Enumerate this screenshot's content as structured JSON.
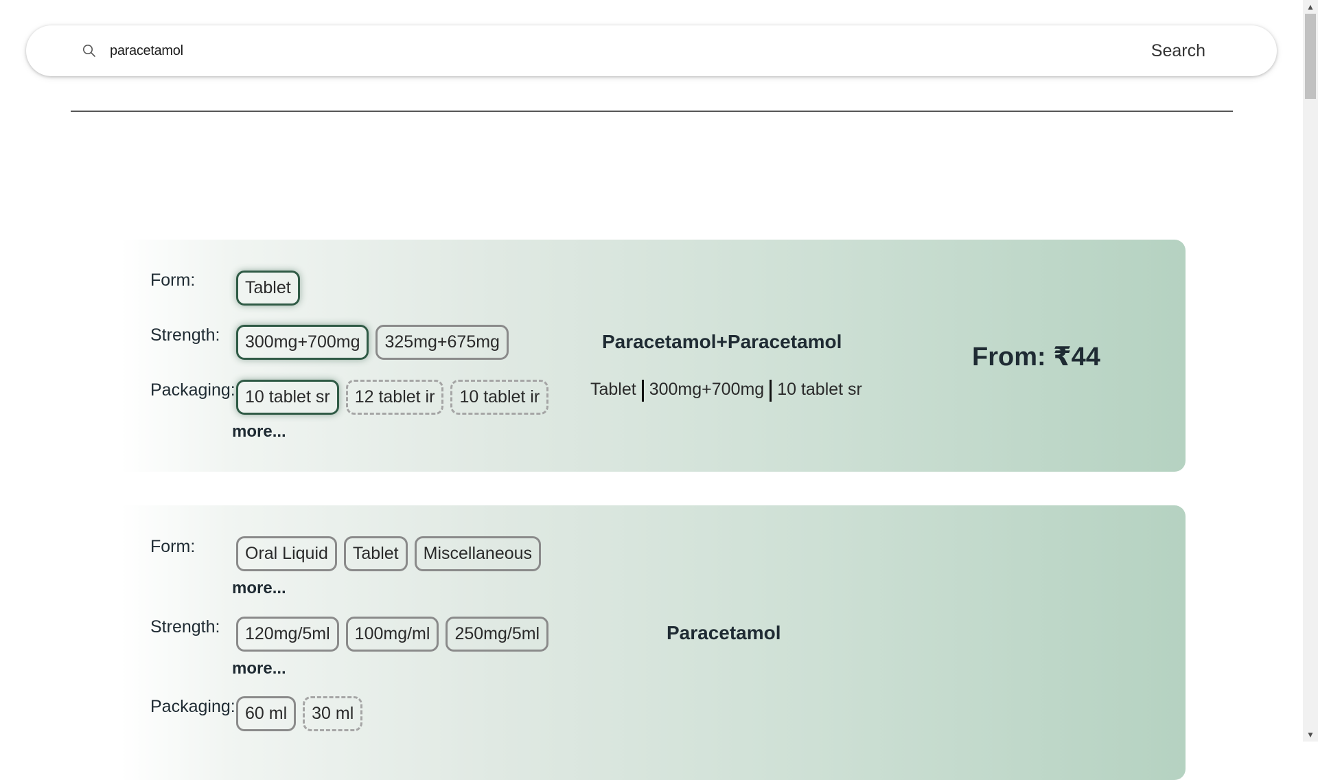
{
  "search": {
    "value": "paracetamol",
    "button_label": "Search"
  },
  "results": [
    {
      "labels": {
        "form": "Form:",
        "strength": "Strength:",
        "packaging": "Packaging:"
      },
      "form_options": [
        "Tablet"
      ],
      "strength_options": [
        "300mg+700mg",
        "325mg+675mg"
      ],
      "packaging_options": [
        "10 tablet sr",
        "12 tablet ir",
        "10 tablet ir"
      ],
      "more_label": "more...",
      "name": "Paracetamol+Paracetamol",
      "summary": [
        "Tablet",
        "300mg+700mg",
        "10 tablet sr"
      ],
      "price": "From: ₹44"
    },
    {
      "labels": {
        "form": "Form:",
        "strength": "Strength:",
        "packaging": "Packaging:"
      },
      "form_options": [
        "Oral Liquid",
        "Tablet",
        "Miscellaneous"
      ],
      "strength_options": [
        "120mg/5ml",
        "100mg/ml",
        "250mg/5ml"
      ],
      "packaging_options": [
        "60 ml",
        "30 ml"
      ],
      "more_label": "more...",
      "name": "Paracetamol"
    }
  ]
}
